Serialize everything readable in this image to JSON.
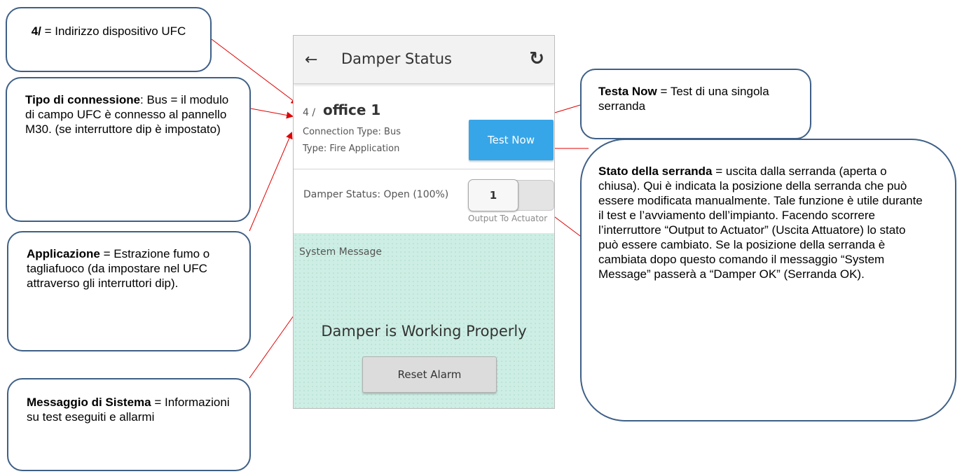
{
  "app": {
    "title": "Damper Status",
    "back_icon": "arrow-left-icon",
    "refresh_icon": "refresh-icon"
  },
  "device": {
    "address": "4 /",
    "name": "office 1",
    "connection_type": "Connection Type: Bus",
    "type": "Type: Fire Application",
    "test_button": "Test Now"
  },
  "damper": {
    "status_label": "Damper Status: Open (100%)",
    "toggle_value": "1",
    "toggle_caption": "Output To Actuator"
  },
  "system_message": {
    "title": "System Message",
    "text": "Damper is Working Properly",
    "reset_button": "Reset Alarm"
  },
  "callouts": {
    "address": {
      "bold": "4/",
      "rest": " = Indirizzo dispositivo UFC"
    },
    "connection": {
      "bold": "Tipo di connessione",
      "rest": ": Bus = il modulo di campo UFC è connesso al pannello M30. (se interruttore dip è impostato)"
    },
    "application": {
      "bold": "Applicazione",
      "rest": " = Estrazione fumo o tagliafuoco (da impostare nel UFC attraverso gli interruttori dip)."
    },
    "system_message": {
      "bold": "Messaggio di Sistema",
      "rest": " = Informazioni su test eseguiti e allarmi"
    },
    "test_now": {
      "bold": "Testa Now",
      "rest": " = Test di una singola serranda"
    },
    "damper_state": {
      "bold": "Stato della serranda",
      "rest": " = uscita dalla serranda (aperta o chiusa). Qui è indicata la posizione della serranda che può essere modificata manualmente. Tale funzione è utile durante il test e l’avviamento dell’impianto. Facendo scorrere l’interruttore “Output to Actuator” (Uscita Attuatore) lo stato può essere cambiato. Se la posizione della serranda è cambiata dopo questo comando il messaggio “System Message” passerà a “Damper OK” (Serranda OK)."
    }
  },
  "colors": {
    "callout_border": "#3e5f86",
    "leader_line": "#e00000",
    "test_button": "#37a6e8",
    "message_background": "#cdeee4"
  }
}
